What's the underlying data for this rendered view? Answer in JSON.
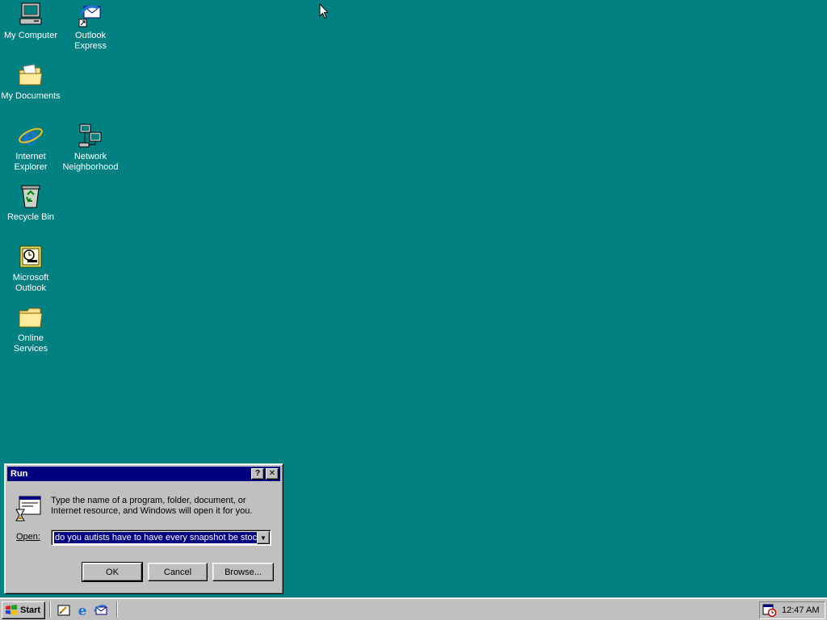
{
  "desktop": {
    "background": "#008080",
    "icons": {
      "my_computer": "My Computer",
      "outlook_express_1": "Outlook",
      "outlook_express_2": "Express",
      "my_documents": "My Documents",
      "internet_explorer_1": "Internet",
      "internet_explorer_2": "Explorer",
      "network_neighborhood_1": "Network",
      "network_neighborhood_2": "Neighborhood",
      "recycle_bin": "Recycle Bin",
      "microsoft_outlook_1": "Microsoft",
      "microsoft_outlook_2": "Outlook",
      "online_services_1": "Online",
      "online_services_2": "Services"
    }
  },
  "run_dialog": {
    "title": "Run",
    "help_glyph": "?",
    "close_glyph": "✕",
    "description": "Type the name of a program, folder, document, or Internet resource, and Windows will open it for you.",
    "open_label": "Open:",
    "open_value": "do you autists have to have every snapshot be stock",
    "ok_label": "OK",
    "cancel_label": "Cancel",
    "browse_label": "Browse..."
  },
  "taskbar": {
    "start_label": "Start",
    "clock": "12:47 AM"
  }
}
